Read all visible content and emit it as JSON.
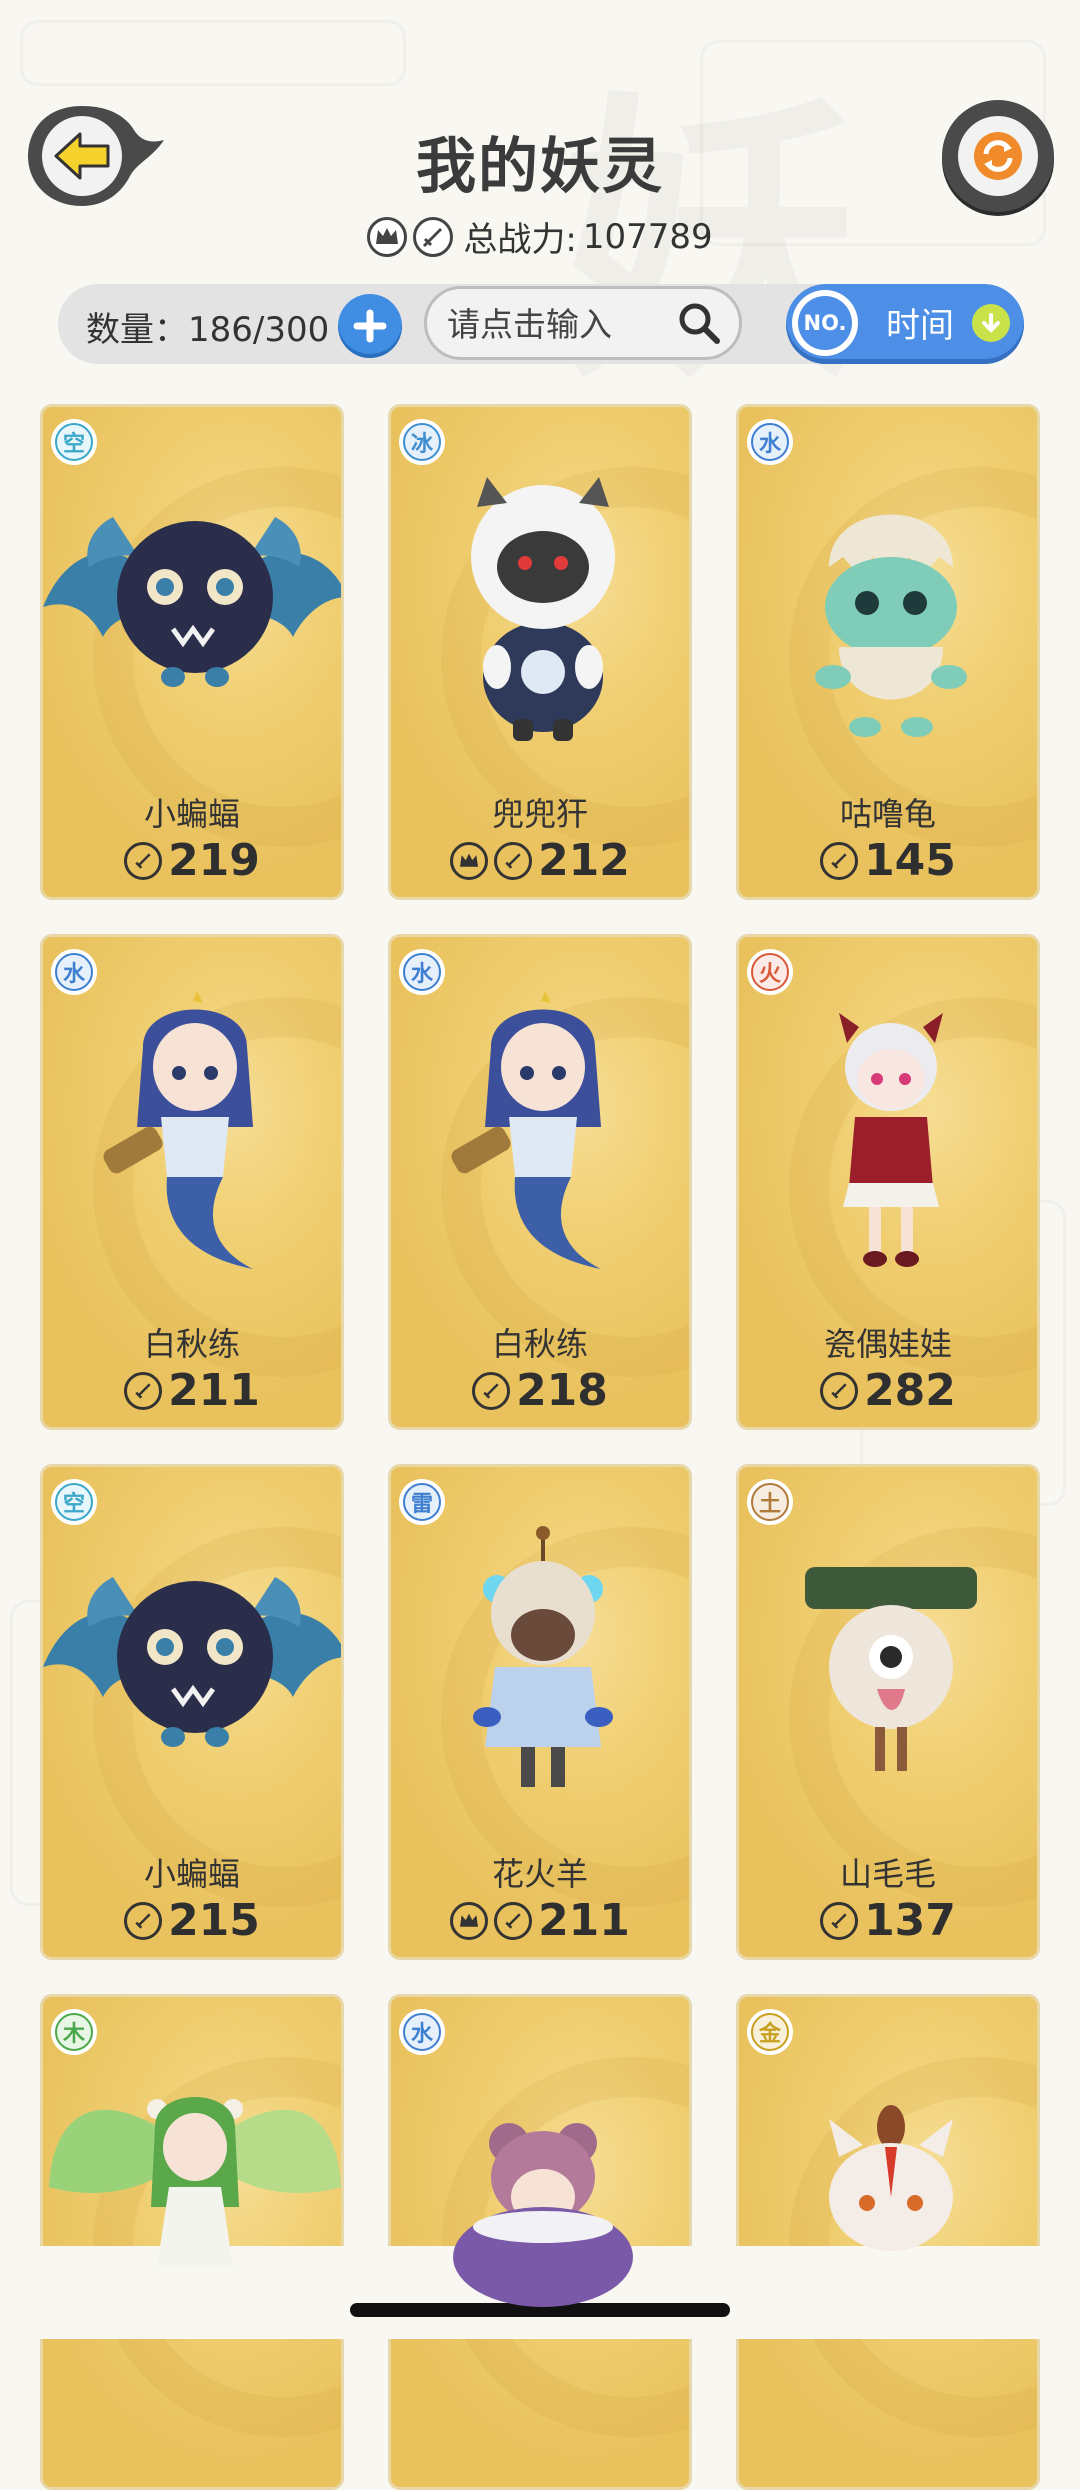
{
  "header": {
    "title": "我的妖灵",
    "power_label": "总战力:",
    "power_value": "107789"
  },
  "toolbar": {
    "count_text": "数量：186/300",
    "search_placeholder": "请点击输入",
    "sort_no": "NO.",
    "sort_label": "时间"
  },
  "cards": [
    {
      "element": "空",
      "name": "小蝙蝠",
      "power": "219",
      "crown": false
    },
    {
      "element": "冰",
      "name": "兜兜犴",
      "power": "212",
      "crown": true
    },
    {
      "element": "水",
      "name": "咕噜龟",
      "power": "145",
      "crown": false
    },
    {
      "element": "水",
      "name": "白秋练",
      "power": "211",
      "crown": false
    },
    {
      "element": "水",
      "name": "白秋练",
      "power": "218",
      "crown": false
    },
    {
      "element": "火",
      "name": "瓷偶娃娃",
      "power": "282",
      "crown": false
    },
    {
      "element": "空",
      "name": "小蝙蝠",
      "power": "215",
      "crown": false
    },
    {
      "element": "雷",
      "name": "花火羊",
      "power": "211",
      "crown": true
    },
    {
      "element": "土",
      "name": "山毛毛",
      "power": "137",
      "crown": false
    },
    {
      "element": "木",
      "name": "",
      "power": "",
      "crown": false
    },
    {
      "element": "水",
      "name": "",
      "power": "",
      "crown": false
    },
    {
      "element": "金",
      "name": "",
      "power": "",
      "crown": false
    }
  ],
  "colors": {
    "card_gold": "#f0cf72",
    "accent_blue": "#4d8fe6",
    "element_kong": "#3aa6c8",
    "element_bing": "#3f8fd0",
    "element_shui": "#3f7fd0",
    "element_huo": "#d85a3a",
    "element_lei": "#3f7fd0",
    "element_tu": "#b07a3a",
    "element_mu": "#4aa84a",
    "element_jin": "#c7a020"
  }
}
